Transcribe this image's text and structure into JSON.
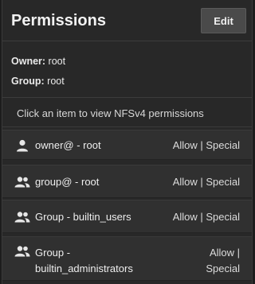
{
  "panel": {
    "title": "Permissions",
    "edit_label": "Edit",
    "owner_key": "Owner:",
    "owner_value": "root",
    "group_key": "Group:",
    "group_value": "root",
    "hint": "Click an item to view NFSv4 permissions"
  },
  "items": [
    {
      "icon": "user-icon",
      "label": "owner@ - root",
      "perm": "Allow | Special"
    },
    {
      "icon": "group-icon",
      "label": "group@ - root",
      "perm": "Allow | Special"
    },
    {
      "icon": "group-icon",
      "label": "Group - builtin_users",
      "perm": "Allow | Special"
    },
    {
      "icon": "group-icon",
      "label_line1": "Group -",
      "label_line2": "builtin_administrators",
      "perm_line1": "Allow |",
      "perm_line2": "Special"
    }
  ],
  "colors": {
    "background": "#282828",
    "item_background": "#303030",
    "button_background": "#4a4a4a"
  }
}
